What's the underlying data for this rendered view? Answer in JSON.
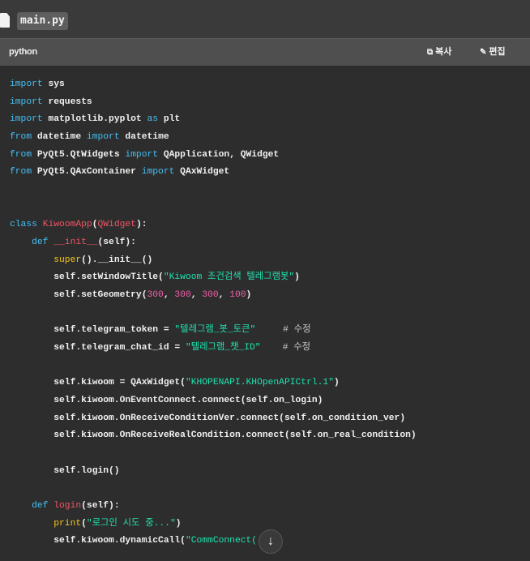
{
  "file": {
    "name": "main.py",
    "icon": "file-icon"
  },
  "header": {
    "language": "python",
    "copy_label": "복사",
    "edit_label": "편집",
    "copy_icon": "copy-icon",
    "edit_icon": "pencil-icon"
  },
  "code": {
    "lines": [
      {
        "tokens": [
          {
            "c": "kw",
            "t": "import"
          },
          {
            "c": "",
            "t": " sys"
          }
        ]
      },
      {
        "tokens": [
          {
            "c": "kw",
            "t": "import"
          },
          {
            "c": "",
            "t": " requests"
          }
        ]
      },
      {
        "tokens": [
          {
            "c": "kw",
            "t": "import"
          },
          {
            "c": "",
            "t": " matplotlib.pyplot "
          },
          {
            "c": "kw",
            "t": "as"
          },
          {
            "c": "",
            "t": " plt"
          }
        ]
      },
      {
        "tokens": [
          {
            "c": "kw",
            "t": "from"
          },
          {
            "c": "",
            "t": " datetime "
          },
          {
            "c": "kw",
            "t": "import"
          },
          {
            "c": "",
            "t": " datetime"
          }
        ]
      },
      {
        "tokens": [
          {
            "c": "kw",
            "t": "from"
          },
          {
            "c": "",
            "t": " PyQt5.QtWidgets "
          },
          {
            "c": "kw",
            "t": "import"
          },
          {
            "c": "",
            "t": " QApplication, QWidget"
          }
        ]
      },
      {
        "tokens": [
          {
            "c": "kw",
            "t": "from"
          },
          {
            "c": "",
            "t": " PyQt5.QAxContainer "
          },
          {
            "c": "kw",
            "t": "import"
          },
          {
            "c": "",
            "t": " QAxWidget"
          }
        ]
      },
      {
        "tokens": []
      },
      {
        "tokens": []
      },
      {
        "tokens": [
          {
            "c": "kw",
            "t": "class"
          },
          {
            "c": "",
            "t": " "
          },
          {
            "c": "cls",
            "t": "KiwoomApp"
          },
          {
            "c": "",
            "t": "("
          },
          {
            "c": "cls",
            "t": "QWidget"
          },
          {
            "c": "",
            "t": "):"
          }
        ]
      },
      {
        "tokens": [
          {
            "c": "",
            "t": "    "
          },
          {
            "c": "kw",
            "t": "def"
          },
          {
            "c": "",
            "t": " "
          },
          {
            "c": "cls",
            "t": "__init__"
          },
          {
            "c": "",
            "t": "(self):"
          }
        ]
      },
      {
        "tokens": [
          {
            "c": "",
            "t": "        "
          },
          {
            "c": "bi",
            "t": "super"
          },
          {
            "c": "",
            "t": "().__init__()"
          }
        ]
      },
      {
        "tokens": [
          {
            "c": "",
            "t": "        self.setWindowTitle("
          },
          {
            "c": "str",
            "t": "\"Kiwoom 조건검색 텔레그램봇\""
          },
          {
            "c": "",
            "t": ")"
          }
        ]
      },
      {
        "tokens": [
          {
            "c": "",
            "t": "        self.setGeometry("
          },
          {
            "c": "num",
            "t": "300"
          },
          {
            "c": "",
            "t": ", "
          },
          {
            "c": "num",
            "t": "300"
          },
          {
            "c": "",
            "t": ", "
          },
          {
            "c": "num",
            "t": "300"
          },
          {
            "c": "",
            "t": ", "
          },
          {
            "c": "num",
            "t": "100"
          },
          {
            "c": "",
            "t": ")"
          }
        ]
      },
      {
        "tokens": []
      },
      {
        "tokens": [
          {
            "c": "",
            "t": "        self.telegram_token = "
          },
          {
            "c": "str",
            "t": "\"텔레그램_봇_토큰\""
          },
          {
            "c": "",
            "t": "     "
          },
          {
            "c": "cm",
            "t": "# 수정"
          }
        ]
      },
      {
        "tokens": [
          {
            "c": "",
            "t": "        self.telegram_chat_id = "
          },
          {
            "c": "str",
            "t": "\"텔레그램_챗_ID\""
          },
          {
            "c": "",
            "t": "    "
          },
          {
            "c": "cm",
            "t": "# 수정"
          }
        ]
      },
      {
        "tokens": []
      },
      {
        "tokens": [
          {
            "c": "",
            "t": "        self.kiwoom = QAxWidget("
          },
          {
            "c": "str",
            "t": "\"KHOPENAPI.KHOpenAPICtrl.1\""
          },
          {
            "c": "",
            "t": ")"
          }
        ]
      },
      {
        "tokens": [
          {
            "c": "",
            "t": "        self.kiwoom.OnEventConnect.connect(self.on_login)"
          }
        ]
      },
      {
        "tokens": [
          {
            "c": "",
            "t": "        self.kiwoom.OnReceiveConditionVer.connect(self.on_condition_ver)"
          }
        ]
      },
      {
        "tokens": [
          {
            "c": "",
            "t": "        self.kiwoom.OnReceiveRealCondition.connect(self.on_real_condition)"
          }
        ]
      },
      {
        "tokens": []
      },
      {
        "tokens": [
          {
            "c": "",
            "t": "        self.login()"
          }
        ]
      },
      {
        "tokens": []
      },
      {
        "tokens": [
          {
            "c": "",
            "t": "    "
          },
          {
            "c": "kw",
            "t": "def"
          },
          {
            "c": "",
            "t": " "
          },
          {
            "c": "cls",
            "t": "login"
          },
          {
            "c": "",
            "t": "(self):"
          }
        ]
      },
      {
        "tokens": [
          {
            "c": "",
            "t": "        "
          },
          {
            "c": "bi",
            "t": "print"
          },
          {
            "c": "",
            "t": "("
          },
          {
            "c": "str",
            "t": "\"로그인 시도 중...\""
          },
          {
            "c": "",
            "t": ")"
          }
        ]
      },
      {
        "tokens": [
          {
            "c": "",
            "t": "        self.kiwoom.dynamicCall("
          },
          {
            "c": "str",
            "t": "\"CommConnect("
          }
        ]
      }
    ]
  },
  "scroll_button": {
    "icon": "arrow-down-icon",
    "glyph": "↓"
  }
}
